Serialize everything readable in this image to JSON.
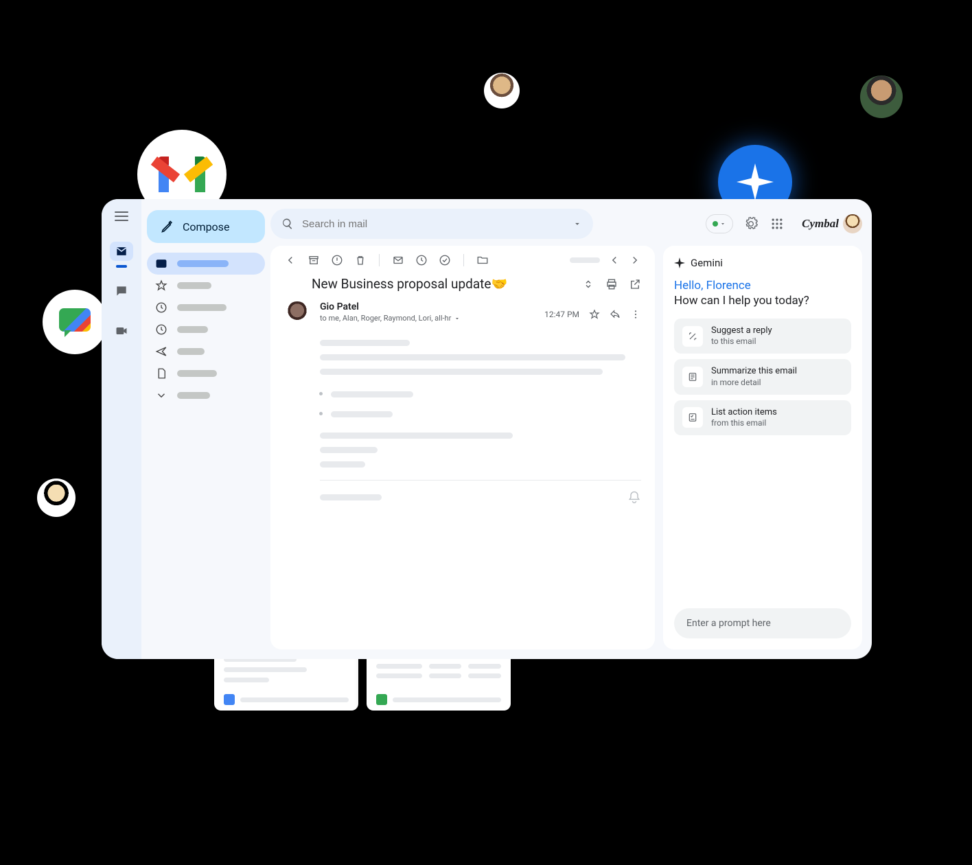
{
  "search": {
    "placeholder": "Search in mail"
  },
  "compose_label": "Compose",
  "brand": "Cymbal",
  "email": {
    "subject": "New Business proposal update🤝",
    "sender": "Gio Patel",
    "recipients": "to me, Alan, Roger, Raymond, Lori, all-hr",
    "time": "12:47 PM"
  },
  "gemini": {
    "title": "Gemini",
    "greeting": "Hello, Florence",
    "subgreeting": "How can I help you today?",
    "suggestions": [
      {
        "title": "Suggest a reply",
        "sub": "to this email"
      },
      {
        "title": "Summarize this email",
        "sub": "in more detail"
      },
      {
        "title": "List action items",
        "sub": "from this email"
      }
    ],
    "prompt_placeholder": "Enter a prompt here"
  }
}
